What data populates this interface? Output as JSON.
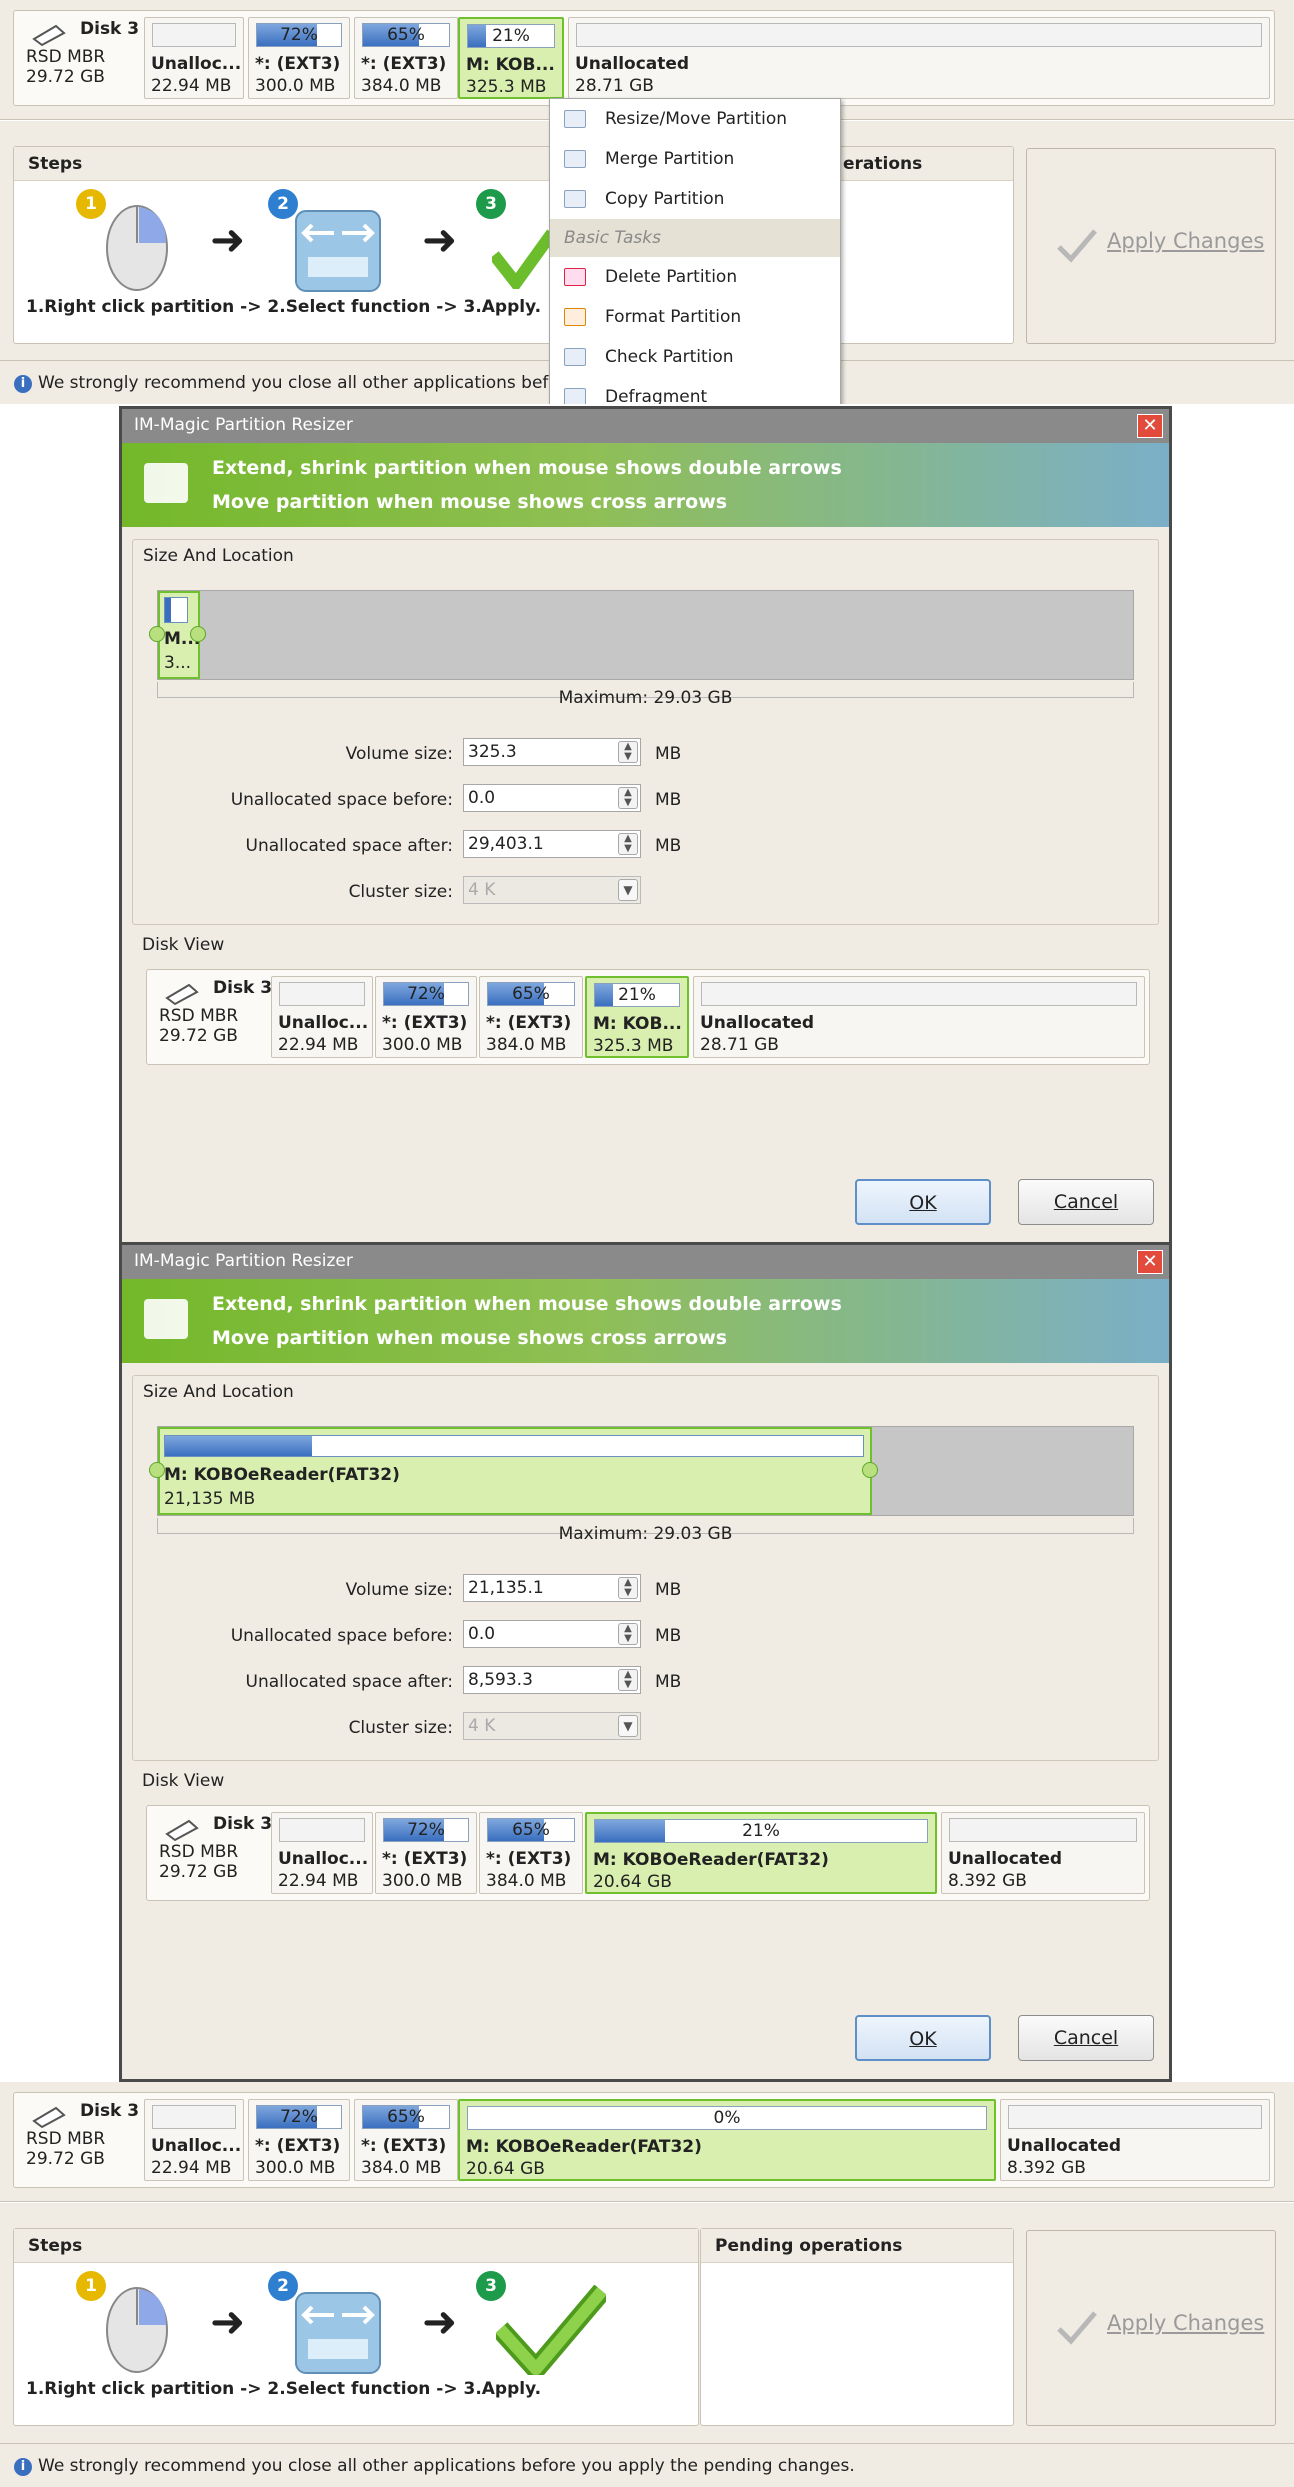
{
  "disk": {
    "name": "Disk 3",
    "type": "RSD MBR",
    "size": "29.72 GB"
  },
  "top_partitions": [
    {
      "percent": "",
      "name": "Unalloc...",
      "size": "22.94 MB",
      "fill": 0
    },
    {
      "percent": "72%",
      "name": "*: (EXT3)",
      "size": "300.0 MB",
      "fill": 0.72
    },
    {
      "percent": "65%",
      "name": "*: (EXT3)",
      "size": "384.0 MB",
      "fill": 0.65
    },
    {
      "percent": "21%",
      "name": "M: KOB...",
      "size": "325.3 MB",
      "fill": 0.21
    },
    {
      "percent": "",
      "name": "Unallocated",
      "size": "28.71 GB",
      "fill": 0
    }
  ],
  "steps": {
    "title": "Steps",
    "text": "1.Right click partition -> 2.Select function -> 3.Apply.",
    "text_short": "1.Right click partition -> 2.Select function -> 3.Apply.",
    "n1": "1",
    "n2": "2",
    "n3": "3",
    "arrow": "➜"
  },
  "pending": {
    "title": "Pending operations",
    "title_partial": "erations"
  },
  "apply_label": "Apply Changes",
  "status_text": "We strongly recommend you close all other applications before you apply the pending changes.",
  "status_text_partial": "We strongly recommend you close all other applications before",
  "context_menu": {
    "items": [
      "Resize/Move Partition",
      "Merge Partition",
      "Copy Partition"
    ],
    "group": "Basic Tasks",
    "items2": [
      "Delete Partition",
      "Format Partition",
      "Check Partition",
      "Defragment"
    ]
  },
  "dialog": {
    "title": "IM-Magic Partition Resizer",
    "close": "✕",
    "banner1": "Extend, shrink partition when mouse shows double arrows",
    "banner2": "Move partition when mouse shows cross arrows",
    "size_section": "Size And Location",
    "maximum": "Maximum: 29.03 GB",
    "labels": {
      "volume": "Volume size:",
      "before": "Unallocated space before:",
      "after": "Unallocated space after:",
      "cluster": "Cluster size:"
    },
    "unit": "MB",
    "cluster_value": "4 K",
    "disk_view": "Disk View",
    "ok": "OK",
    "cancel": "Cancel"
  },
  "dialog1": {
    "slot_name": "M...",
    "slot_size": "3...",
    "volume": "325.3",
    "before": "0.0",
    "after": "29,403.1",
    "view_partitions": [
      {
        "percent": "",
        "name": "Unalloc...",
        "size": "22.94 MB",
        "fill": 0
      },
      {
        "percent": "72%",
        "name": "*: (EXT3)",
        "size": "300.0 MB",
        "fill": 0.72
      },
      {
        "percent": "65%",
        "name": "*: (EXT3)",
        "size": "384.0 MB",
        "fill": 0.65
      },
      {
        "percent": "21%",
        "name": "M: KOB...",
        "size": "325.3 MB",
        "fill": 0.21
      },
      {
        "percent": "",
        "name": "Unallocated",
        "size": "28.71 GB",
        "fill": 0
      }
    ]
  },
  "dialog2": {
    "slot_name": "M: KOBOeReader(FAT32)",
    "slot_size": "21,135 MB",
    "slot_fill": 0.21,
    "volume": "21,135.1",
    "before": "0.0",
    "after": "8,593.3",
    "view_partitions": [
      {
        "percent": "",
        "name": "Unalloc...",
        "size": "22.94 MB",
        "fill": 0
      },
      {
        "percent": "72%",
        "name": "*: (EXT3)",
        "size": "300.0 MB",
        "fill": 0.72
      },
      {
        "percent": "65%",
        "name": "*: (EXT3)",
        "size": "384.0 MB",
        "fill": 0.65
      },
      {
        "percent": "21%",
        "name": "M: KOBOeReader(FAT32)",
        "size": "20.64 GB",
        "fill": 0.21
      },
      {
        "percent": "",
        "name": "Unallocated",
        "size": "8.392 GB",
        "fill": 0
      }
    ]
  },
  "bottom_partitions": [
    {
      "percent": "",
      "name": "Unalloc...",
      "size": "22.94 MB",
      "fill": 0
    },
    {
      "percent": "72%",
      "name": "*: (EXT3)",
      "size": "300.0 MB",
      "fill": 0.72
    },
    {
      "percent": "65%",
      "name": "*: (EXT3)",
      "size": "384.0 MB",
      "fill": 0.65
    },
    {
      "percent": "0%",
      "name": "M: KOBOeReader(FAT32)",
      "size": "20.64 GB",
      "fill": 0
    },
    {
      "percent": "",
      "name": "Unallocated",
      "size": "8.392 GB",
      "fill": 0
    }
  ]
}
